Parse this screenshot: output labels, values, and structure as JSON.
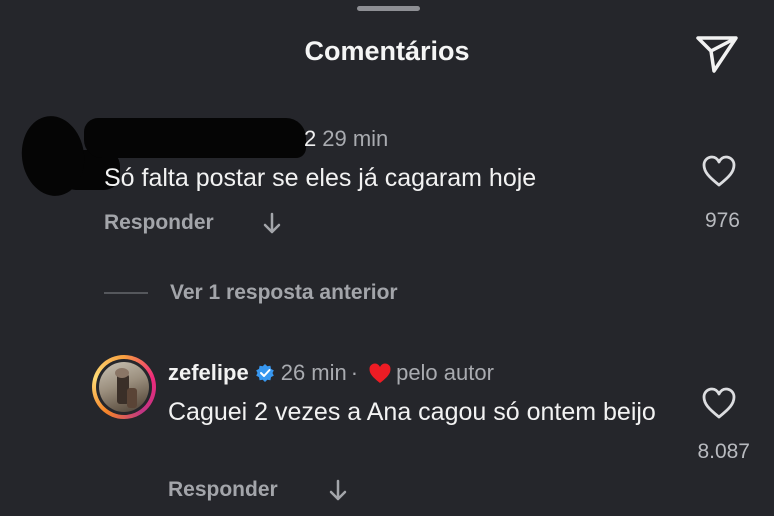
{
  "header": {
    "title": "Comentários",
    "share_icon": "paper-plane-icon"
  },
  "comments": [
    {
      "username": "",
      "reply_number": "2",
      "time": "29 min",
      "text": "Só falta postar se eles já cagaram hoje",
      "reply_label": "Responder",
      "likes": "976"
    },
    {
      "username": "zefelipe",
      "verified": true,
      "time": "26 min",
      "separator": "·",
      "liked_by_author": "pelo autor",
      "text": "Caguei 2 vezes a Ana cagou só ontem beijo",
      "reply_label": "Responder",
      "likes": "8.087"
    }
  ],
  "view_replies": "Ver 1 resposta anterior",
  "colors": {
    "background": "#25262b",
    "muted_text": "#a9abb0",
    "verified_blue": "#3797f0",
    "author_heart": "#ed1c24"
  }
}
